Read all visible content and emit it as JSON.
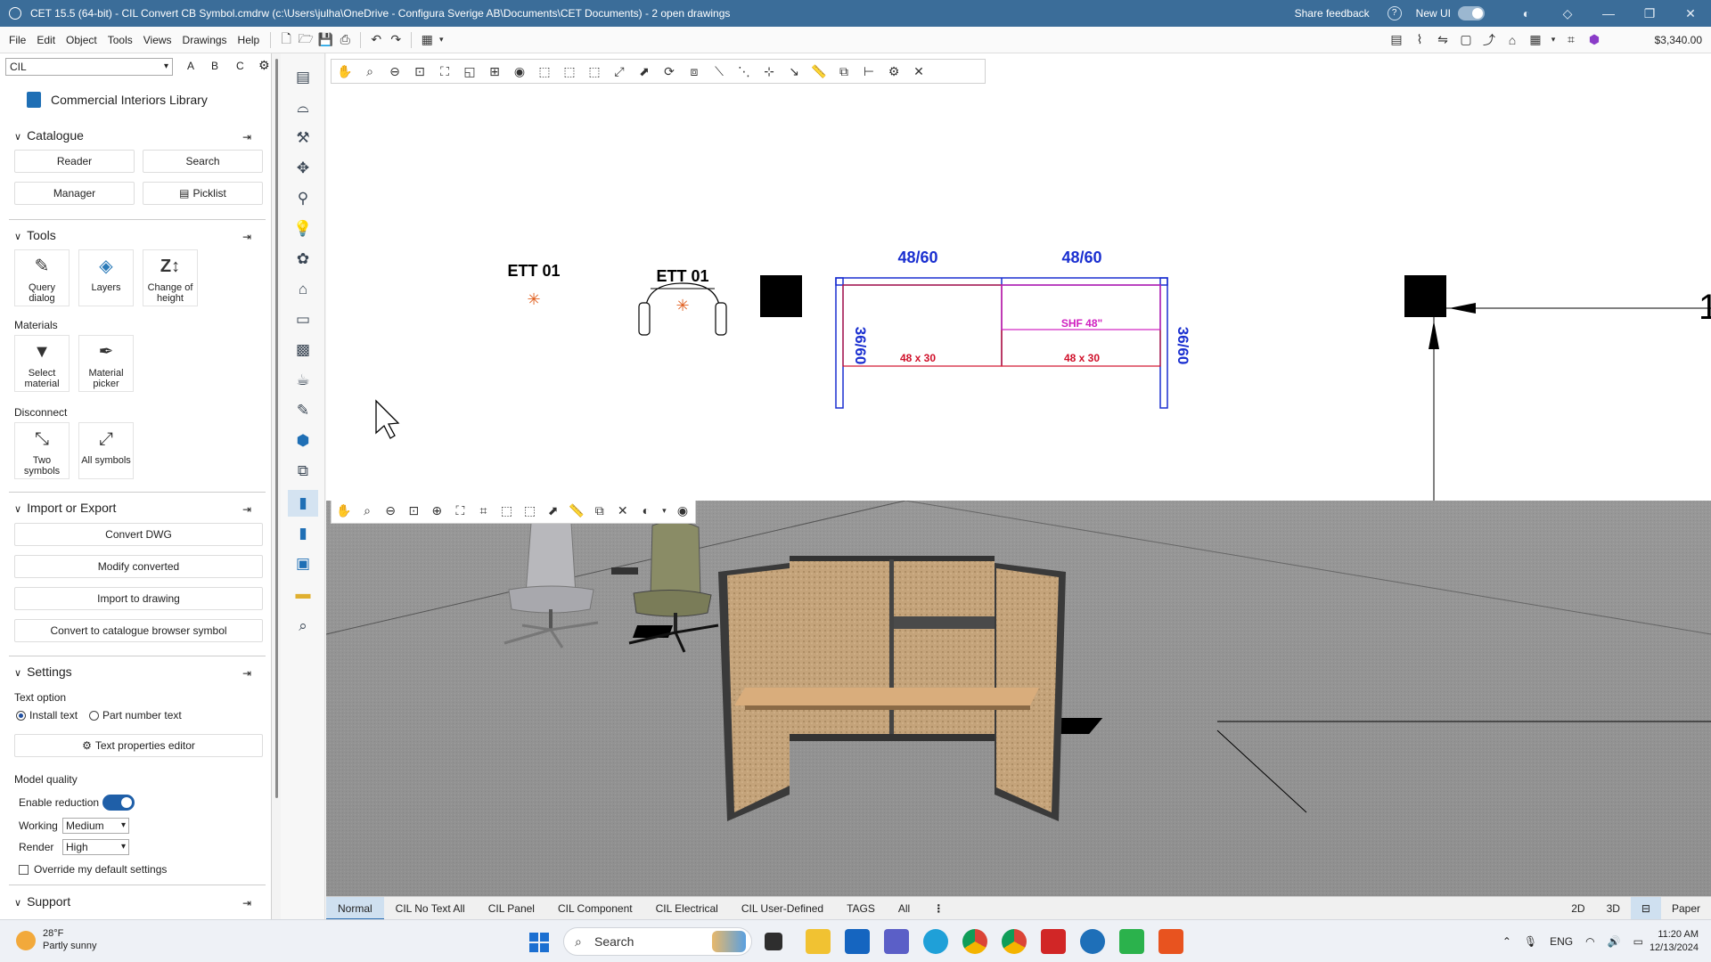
{
  "titlebar": {
    "title": "CET 15.5 (64-bit) - CIL Convert CB Symbol.cmdrw (c:\\Users\\julha\\OneDrive - Configura Sverige AB\\Documents\\CET Documents) - 2  open drawings",
    "share_feedback": "Share feedback",
    "new_ui": "New UI"
  },
  "menu": {
    "items": [
      "File",
      "Edit",
      "Object",
      "Tools",
      "Views",
      "Drawings",
      "Help"
    ],
    "price": "$3,340.00"
  },
  "left": {
    "search_value": "CIL",
    "filter_letters": [
      "A",
      "B",
      "C"
    ],
    "library_title": "Commercial Interiors Library",
    "catalogue": {
      "title": "Catalogue",
      "buttons": [
        "Reader",
        "Search",
        "Manager",
        "Picklist"
      ]
    },
    "tools": {
      "title": "Tools",
      "tiles": [
        "Query dialog",
        "Layers",
        "Change of height"
      ],
      "materials_label": "Materials",
      "materials_tiles": [
        "Select material",
        "Material picker"
      ],
      "disconnect_label": "Disconnect",
      "disconnect_tiles": [
        "Two symbols",
        "All symbols"
      ]
    },
    "import_export": {
      "title": "Import or Export",
      "buttons": [
        "Convert DWG",
        "Modify converted",
        "Import to drawing",
        "Convert to catalogue browser symbol"
      ]
    },
    "settings": {
      "title": "Settings",
      "text_option_label": "Text option",
      "radio_install": "Install text",
      "radio_part": "Part number text",
      "text_props_button": "Text properties editor",
      "model_quality_label": "Model quality",
      "enable_reduction": "Enable reduction",
      "working_label": "Working",
      "working_value": "Medium",
      "render_label": "Render",
      "render_value": "High",
      "override": "Override my default settings"
    },
    "support": {
      "title": "Support"
    }
  },
  "drawing": {
    "label_left": "ETT 01",
    "label_chair": "ETT 01",
    "dim_top_left": "48/60",
    "dim_top_right": "48/60",
    "dim_side_left": "36/60",
    "dim_side_right": "36/60",
    "desk_left": "48 x 30",
    "desk_right": "48 x 30",
    "shelf": "SHF 48\"",
    "edge_number": "1"
  },
  "status_tabs": [
    "Normal",
    "CIL No Text All",
    "CIL Panel",
    "CIL Component",
    "CIL Electrical",
    "CIL User-Defined",
    "TAGS",
    "All"
  ],
  "status_right": [
    "2D",
    "3D",
    "Paper"
  ],
  "taskbar": {
    "temp": "28°F",
    "weather": "Partly sunny",
    "search": "Search",
    "lang": "ENG",
    "time": "11:20 AM",
    "date": "12/13/2024"
  },
  "colors": {
    "titlebar": "#3b6d99",
    "dimension_blue": "#1a2fd0",
    "desk_red": "#d0102a",
    "shelf_magenta": "#d020c0",
    "accent": "#1f5fa8"
  }
}
